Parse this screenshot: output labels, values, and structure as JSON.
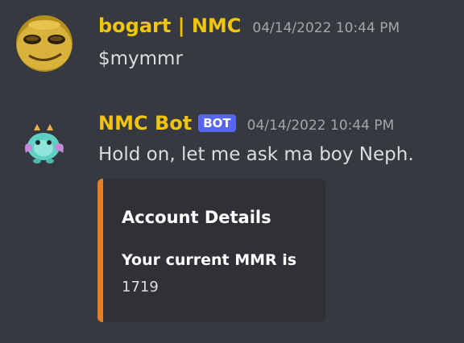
{
  "messages": [
    {
      "author": "bogart | NMC",
      "author_color": "#f1c40f",
      "timestamp": "04/14/2022 10:44 PM",
      "content": "$mymmr"
    },
    {
      "author": "NMC Bot",
      "author_color": "#f1c40f",
      "bot_tag": "BOT",
      "timestamp": "04/14/2022 10:44 PM",
      "content": "Hold on, let me ask ma boy Neph.",
      "embed": {
        "accent_color": "#e67e22",
        "title": "Account Details",
        "field_name": "Your current MMR is",
        "field_value": "1719"
      }
    }
  ]
}
